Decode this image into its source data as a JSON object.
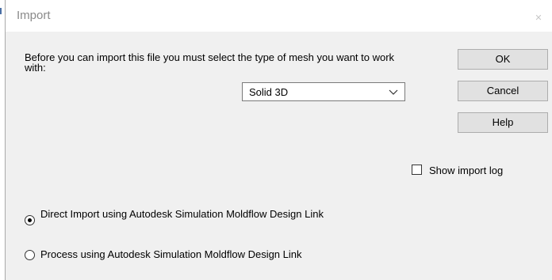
{
  "window": {
    "title": "Import",
    "close_glyph": "✕"
  },
  "content": {
    "instruction": "Before you can import this file you must select the type of mesh you want to work with:",
    "mesh_type": {
      "selected": "Solid 3D"
    }
  },
  "buttons": {
    "ok": "OK",
    "cancel": "Cancel",
    "help": "Help"
  },
  "options": {
    "show_import_log": {
      "label": "Show import log",
      "checked": false
    },
    "import_method": [
      {
        "label": "Direct Import using Autodesk Simulation Moldflow Design Link",
        "selected": true
      },
      {
        "label": "Process using Autodesk Simulation Moldflow Design Link",
        "selected": false
      }
    ]
  },
  "icons": {
    "close": "close-icon",
    "dropdown": "chevron-down-icon"
  },
  "colors": {
    "dialog_bg": "#f0f0f0",
    "title_text": "#8a8a8a",
    "button_bg": "#e1e1e1"
  }
}
